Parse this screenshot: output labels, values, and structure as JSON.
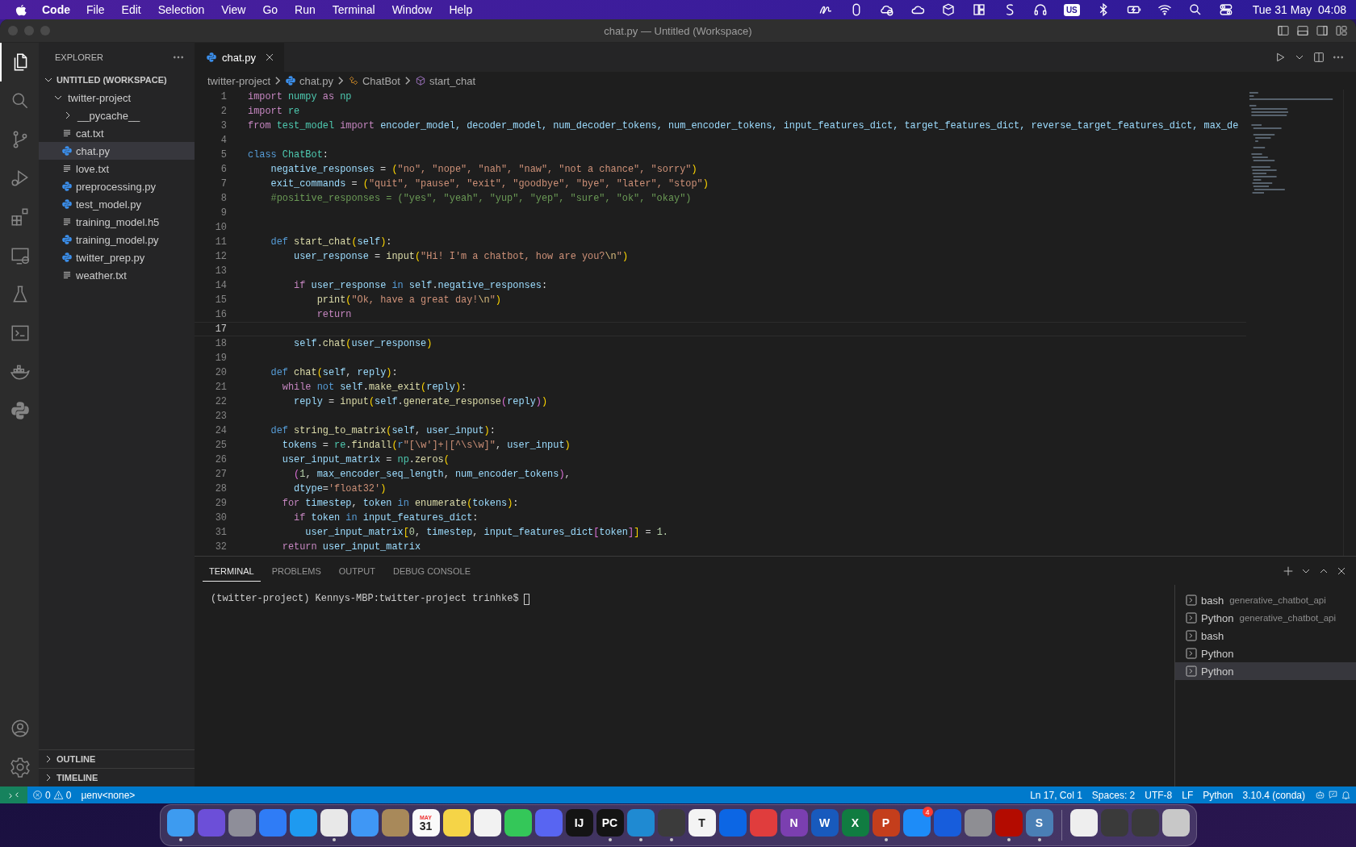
{
  "menu_bar": {
    "app": "Code",
    "menus": [
      "File",
      "Edit",
      "Selection",
      "View",
      "Go",
      "Run",
      "Terminal",
      "Window",
      "Help"
    ],
    "input_source": "US",
    "clock": "Tue 31 May  04:08"
  },
  "window": {
    "title": "chat.py — Untitled (Workspace)"
  },
  "activity_bar": {
    "items": [
      {
        "selected": true
      },
      {
        "selected": false
      },
      {
        "selected": false
      },
      {
        "selected": false
      },
      {
        "selected": false
      },
      {
        "selected": false
      },
      {
        "selected": false
      },
      {
        "selected": false
      },
      {
        "selected": false
      },
      {
        "selected": false
      }
    ]
  },
  "sidebar": {
    "title": "EXPLORER",
    "workspace": {
      "label": "UNTITLED (WORKSPACE)",
      "expanded": true,
      "children": [
        {
          "label": "twitter-project",
          "kind": "folder",
          "expanded": true,
          "selected": false,
          "children": [
            {
              "label": "__pycache__",
              "kind": "folder",
              "expanded": false,
              "selected": false
            },
            {
              "label": "cat.txt",
              "kind": "text",
              "selected": false
            },
            {
              "label": "chat.py",
              "kind": "python",
              "selected": true
            },
            {
              "label": "love.txt",
              "kind": "text",
              "selected": false
            },
            {
              "label": "preprocessing.py",
              "kind": "python",
              "selected": false
            },
            {
              "label": "test_model.py",
              "kind": "python",
              "selected": false
            },
            {
              "label": "training_model.h5",
              "kind": "text",
              "selected": false
            },
            {
              "label": "training_model.py",
              "kind": "python",
              "selected": false
            },
            {
              "label": "twitter_prep.py",
              "kind": "python",
              "selected": false
            },
            {
              "label": "weather.txt",
              "kind": "text",
              "selected": false
            }
          ]
        }
      ]
    },
    "sections": [
      {
        "label": "OUTLINE",
        "expanded": false
      },
      {
        "label": "TIMELINE",
        "expanded": false
      }
    ]
  },
  "editor": {
    "tabs": [
      {
        "label": "chat.py",
        "kind": "python",
        "selected": true
      }
    ],
    "breadcrumb": [
      {
        "label": "twitter-project",
        "kind": "folder"
      },
      {
        "label": "chat.py",
        "kind": "python"
      },
      {
        "label": "ChatBot",
        "kind": "class"
      },
      {
        "label": "start_chat",
        "kind": "method"
      }
    ],
    "lines": [
      {
        "number": "1",
        "current": false,
        "tokens": [
          {
            "kind": "keyword",
            "text": "import "
          },
          {
            "kind": "type",
            "text": "numpy "
          },
          {
            "kind": "keyword",
            "text": "as "
          },
          {
            "kind": "type",
            "text": "np"
          }
        ]
      },
      {
        "number": "2",
        "current": false,
        "tokens": [
          {
            "kind": "keyword",
            "text": "import "
          },
          {
            "kind": "type",
            "text": "re"
          }
        ]
      },
      {
        "number": "3",
        "current": false,
        "tokens": [
          {
            "kind": "keyword",
            "text": "from "
          },
          {
            "kind": "type",
            "text": "test_model "
          },
          {
            "kind": "keyword",
            "text": "import "
          },
          {
            "kind": "variable",
            "text": "encoder_model, decoder_model, num_decoder_tokens, num_encoder_tokens, input_features_dict, target_features_dict, reverse_target_features_dict, max_de"
          }
        ]
      },
      {
        "number": "4",
        "current": false
      },
      {
        "number": "5",
        "current": false,
        "tokens": [
          {
            "kind": "storage",
            "text": "class "
          },
          {
            "kind": "type",
            "text": "ChatBot"
          },
          {
            "kind": "plain",
            "text": ":"
          }
        ]
      },
      {
        "number": "6",
        "current": false,
        "tokens": [
          {
            "kind": "variable",
            "text": "    negative_responses"
          },
          {
            "kind": "plain",
            "text": " = "
          },
          {
            "kind": "bracket",
            "text": "("
          },
          {
            "kind": "string",
            "text": "\"no\", \"nope\", \"nah\", \"naw\", \"not a chance\", \"sorry\""
          },
          {
            "kind": "bracket",
            "text": ")"
          }
        ]
      },
      {
        "number": "7",
        "current": false,
        "tokens": [
          {
            "kind": "variable",
            "text": "    exit_commands"
          },
          {
            "kind": "plain",
            "text": " = "
          },
          {
            "kind": "bracket",
            "text": "("
          },
          {
            "kind": "string",
            "text": "\"quit\", \"pause\", \"exit\", \"goodbye\", \"bye\", \"later\", \"stop\""
          },
          {
            "kind": "bracket",
            "text": ")"
          }
        ]
      },
      {
        "number": "8",
        "current": false,
        "tokens": [
          {
            "kind": "comment",
            "text": "    #positive_responses = (\"yes\", \"yeah\", \"yup\", \"yep\", \"sure\", \"ok\", \"okay\")"
          }
        ]
      },
      {
        "number": "9",
        "current": false
      },
      {
        "number": "10",
        "current": false
      },
      {
        "number": "11",
        "current": false,
        "tokens": [
          {
            "kind": "storage",
            "text": "    def "
          },
          {
            "kind": "function",
            "text": "start_chat"
          },
          {
            "kind": "bracket",
            "text": "("
          },
          {
            "kind": "variable",
            "text": "self"
          },
          {
            "kind": "bracket",
            "text": ")"
          },
          {
            "kind": "plain",
            "text": ":"
          }
        ]
      },
      {
        "number": "12",
        "current": false,
        "tokens": [
          {
            "kind": "variable",
            "text": "        user_response"
          },
          {
            "kind": "plain",
            "text": " = "
          },
          {
            "kind": "function",
            "text": "input"
          },
          {
            "kind": "bracket",
            "text": "("
          },
          {
            "kind": "string",
            "text": "\"Hi! I'm a chatbot, how are you?"
          },
          {
            "kind": "escape",
            "text": "\\n"
          },
          {
            "kind": "string",
            "text": "\""
          },
          {
            "kind": "bracket",
            "text": ")"
          }
        ]
      },
      {
        "number": "13",
        "current": false
      },
      {
        "number": "14",
        "current": false,
        "tokens": [
          {
            "kind": "keyword",
            "text": "        if "
          },
          {
            "kind": "variable",
            "text": "user_response "
          },
          {
            "kind": "storage",
            "text": "in "
          },
          {
            "kind": "variable",
            "text": "self"
          },
          {
            "kind": "plain",
            "text": "."
          },
          {
            "kind": "variable",
            "text": "negative_responses"
          },
          {
            "kind": "plain",
            "text": ":"
          }
        ]
      },
      {
        "number": "15",
        "current": false,
        "tokens": [
          {
            "kind": "function",
            "text": "            print"
          },
          {
            "kind": "bracket",
            "text": "("
          },
          {
            "kind": "string",
            "text": "\"Ok, have a great day!"
          },
          {
            "kind": "escape",
            "text": "\\n"
          },
          {
            "kind": "string",
            "text": "\""
          },
          {
            "kind": "bracket",
            "text": ")"
          }
        ]
      },
      {
        "number": "16",
        "current": false,
        "tokens": [
          {
            "kind": "keyword",
            "text": "            return"
          }
        ]
      },
      {
        "number": "17",
        "current": true
      },
      {
        "number": "18",
        "current": false,
        "tokens": [
          {
            "kind": "variable",
            "text": "        self"
          },
          {
            "kind": "plain",
            "text": "."
          },
          {
            "kind": "function",
            "text": "chat"
          },
          {
            "kind": "bracket",
            "text": "("
          },
          {
            "kind": "variable",
            "text": "user_response"
          },
          {
            "kind": "bracket",
            "text": ")"
          }
        ]
      },
      {
        "number": "19",
        "current": false
      },
      {
        "number": "20",
        "current": false,
        "tokens": [
          {
            "kind": "storage",
            "text": "    def "
          },
          {
            "kind": "function",
            "text": "chat"
          },
          {
            "kind": "bracket",
            "text": "("
          },
          {
            "kind": "variable",
            "text": "self"
          },
          {
            "kind": "plain",
            "text": ", "
          },
          {
            "kind": "variable",
            "text": "reply"
          },
          {
            "kind": "bracket",
            "text": ")"
          },
          {
            "kind": "plain",
            "text": ":"
          }
        ]
      },
      {
        "number": "21",
        "current": false,
        "tokens": [
          {
            "kind": "keyword",
            "text": "      while "
          },
          {
            "kind": "storage",
            "text": "not "
          },
          {
            "kind": "variable",
            "text": "self"
          },
          {
            "kind": "plain",
            "text": "."
          },
          {
            "kind": "function",
            "text": "make_exit"
          },
          {
            "kind": "bracket",
            "text": "("
          },
          {
            "kind": "variable",
            "text": "reply"
          },
          {
            "kind": "bracket",
            "text": ")"
          },
          {
            "kind": "plain",
            "text": ":"
          }
        ]
      },
      {
        "number": "22",
        "current": false,
        "tokens": [
          {
            "kind": "variable",
            "text": "        reply"
          },
          {
            "kind": "plain",
            "text": " = "
          },
          {
            "kind": "function",
            "text": "input"
          },
          {
            "kind": "bracket",
            "text": "("
          },
          {
            "kind": "variable",
            "text": "self"
          },
          {
            "kind": "plain",
            "text": "."
          },
          {
            "kind": "function",
            "text": "generate_response"
          },
          {
            "kind": "bracket2",
            "text": "("
          },
          {
            "kind": "variable",
            "text": "reply"
          },
          {
            "kind": "bracket2",
            "text": ")"
          },
          {
            "kind": "bracket",
            "text": ")"
          }
        ]
      },
      {
        "number": "23",
        "current": false
      },
      {
        "number": "24",
        "current": false,
        "tokens": [
          {
            "kind": "storage",
            "text": "    def "
          },
          {
            "kind": "function",
            "text": "string_to_matrix"
          },
          {
            "kind": "bracket",
            "text": "("
          },
          {
            "kind": "variable",
            "text": "self"
          },
          {
            "kind": "plain",
            "text": ", "
          },
          {
            "kind": "variable",
            "text": "user_input"
          },
          {
            "kind": "bracket",
            "text": ")"
          },
          {
            "kind": "plain",
            "text": ":"
          }
        ]
      },
      {
        "number": "25",
        "current": false,
        "tokens": [
          {
            "kind": "variable",
            "text": "      tokens"
          },
          {
            "kind": "plain",
            "text": " = "
          },
          {
            "kind": "type",
            "text": "re"
          },
          {
            "kind": "plain",
            "text": "."
          },
          {
            "kind": "function",
            "text": "findall"
          },
          {
            "kind": "bracket",
            "text": "("
          },
          {
            "kind": "storage",
            "text": "r"
          },
          {
            "kind": "string",
            "text": "\"[\\w']+|[^\\s\\w]\""
          },
          {
            "kind": "plain",
            "text": ", "
          },
          {
            "kind": "variable",
            "text": "user_input"
          },
          {
            "kind": "bracket",
            "text": ")"
          }
        ]
      },
      {
        "number": "26",
        "current": false,
        "tokens": [
          {
            "kind": "variable",
            "text": "      user_input_matrix"
          },
          {
            "kind": "plain",
            "text": " = "
          },
          {
            "kind": "type",
            "text": "np"
          },
          {
            "kind": "plain",
            "text": "."
          },
          {
            "kind": "function",
            "text": "zeros"
          },
          {
            "kind": "bracket",
            "text": "("
          }
        ]
      },
      {
        "number": "27",
        "current": false,
        "tokens": [
          {
            "kind": "bracket2",
            "text": "        ("
          },
          {
            "kind": "number",
            "text": "1"
          },
          {
            "kind": "plain",
            "text": ", "
          },
          {
            "kind": "variable",
            "text": "max_encoder_seq_length"
          },
          {
            "kind": "plain",
            "text": ", "
          },
          {
            "kind": "variable",
            "text": "num_encoder_tokens"
          },
          {
            "kind": "bracket2",
            "text": ")"
          },
          {
            "kind": "plain",
            "text": ","
          }
        ]
      },
      {
        "number": "28",
        "current": false,
        "tokens": [
          {
            "kind": "variable",
            "text": "        dtype"
          },
          {
            "kind": "plain",
            "text": "="
          },
          {
            "kind": "string",
            "text": "'float32'"
          },
          {
            "kind": "bracket",
            "text": ")"
          }
        ]
      },
      {
        "number": "29",
        "current": false,
        "tokens": [
          {
            "kind": "keyword",
            "text": "      for "
          },
          {
            "kind": "variable",
            "text": "timestep"
          },
          {
            "kind": "plain",
            "text": ", "
          },
          {
            "kind": "variable",
            "text": "token "
          },
          {
            "kind": "storage",
            "text": "in "
          },
          {
            "kind": "function",
            "text": "enumerate"
          },
          {
            "kind": "bracket",
            "text": "("
          },
          {
            "kind": "variable",
            "text": "tokens"
          },
          {
            "kind": "bracket",
            "text": ")"
          },
          {
            "kind": "plain",
            "text": ":"
          }
        ]
      },
      {
        "number": "30",
        "current": false,
        "tokens": [
          {
            "kind": "keyword",
            "text": "        if "
          },
          {
            "kind": "variable",
            "text": "token "
          },
          {
            "kind": "storage",
            "text": "in "
          },
          {
            "kind": "variable",
            "text": "input_features_dict"
          },
          {
            "kind": "plain",
            "text": ":"
          }
        ]
      },
      {
        "number": "31",
        "current": false,
        "tokens": [
          {
            "kind": "variable",
            "text": "          user_input_matrix"
          },
          {
            "kind": "bracket",
            "text": "["
          },
          {
            "kind": "number",
            "text": "0"
          },
          {
            "kind": "plain",
            "text": ", "
          },
          {
            "kind": "variable",
            "text": "timestep"
          },
          {
            "kind": "plain",
            "text": ", "
          },
          {
            "kind": "variable",
            "text": "input_features_dict"
          },
          {
            "kind": "bracket2",
            "text": "["
          },
          {
            "kind": "variable",
            "text": "token"
          },
          {
            "kind": "bracket2",
            "text": "]"
          },
          {
            "kind": "bracket",
            "text": "]"
          },
          {
            "kind": "plain",
            "text": " = "
          },
          {
            "kind": "number",
            "text": "1."
          }
        ]
      },
      {
        "number": "32",
        "current": false,
        "tokens": [
          {
            "kind": "keyword",
            "text": "      return "
          },
          {
            "kind": "variable",
            "text": "user_input_matrix"
          }
        ]
      }
    ]
  },
  "panel": {
    "tabs": [
      {
        "label": "TERMINAL",
        "selected": true
      },
      {
        "label": "PROBLEMS",
        "selected": false
      },
      {
        "label": "OUTPUT",
        "selected": false
      },
      {
        "label": "DEBUG CONSOLE",
        "selected": false
      }
    ],
    "terminal": {
      "prompt": "(twitter-project) Kennys-MBP:twitter-project trinhke$"
    },
    "sessions": [
      {
        "name": "bash",
        "detail": "generative_chatbot_api",
        "selected": false
      },
      {
        "name": "Python",
        "detail": "generative_chatbot_api",
        "selected": false
      },
      {
        "name": "bash",
        "selected": false
      },
      {
        "name": "Python",
        "selected": false
      },
      {
        "name": "Python",
        "selected": true
      }
    ]
  },
  "status_bar": {
    "errors": "0",
    "warnings": "0",
    "env": "µenv<none>",
    "items": [
      "Ln 17, Col 1",
      "Spaces: 2",
      "UTF-8",
      "LF",
      "Python",
      "3.10.4 (conda)"
    ]
  },
  "dock": {
    "apps": [
      {
        "color": "#3d9bf0",
        "running": true
      },
      {
        "color": "#6c4fd8",
        "running": false
      },
      {
        "color": "#8e8e99",
        "running": false
      },
      {
        "color": "#2f7cf6",
        "running": false
      },
      {
        "color": "#1e9af0",
        "running": false
      },
      {
        "color": "#e8e8e8",
        "running": true
      },
      {
        "color": "#3f97f5",
        "running": false
      },
      {
        "color": "#a8895a",
        "running": false
      },
      {
        "color": "#fafafa",
        "label": "31",
        "caption": "MAY",
        "running": false
      },
      {
        "color": "#f5d447",
        "running": false
      },
      {
        "color": "#f2f2f2",
        "running": false
      },
      {
        "color": "#34c759",
        "running": false
      },
      {
        "color": "#5865f2",
        "running": false
      },
      {
        "color": "#141414",
        "label": "IJ",
        "running": false
      },
      {
        "color": "#141414",
        "label": "PC",
        "running": true
      },
      {
        "color": "#1f8ad2",
        "running": true
      },
      {
        "color": "#3b3b3b",
        "running": true
      },
      {
        "color": "#f4f4f4",
        "label": "T",
        "running": false
      },
      {
        "color": "#0c66e4",
        "running": false
      },
      {
        "color": "#e03d3d",
        "running": false
      },
      {
        "color": "#7b3fb0",
        "label": "N",
        "running": false
      },
      {
        "color": "#185abd",
        "label": "W",
        "running": false
      },
      {
        "color": "#107c41",
        "label": "X",
        "running": false
      },
      {
        "color": "#c43e1c",
        "label": "P",
        "running": true
      },
      {
        "color": "#1d8cf8",
        "badge": "4",
        "running": false
      },
      {
        "color": "#175ddc",
        "running": false
      },
      {
        "color": "#8e8e93",
        "running": false
      },
      {
        "color": "#b30b00",
        "running": true
      },
      {
        "color": "#4a7fb5",
        "label": "S",
        "running": true
      }
    ],
    "extras": [
      {
        "color": "#eeeeee"
      },
      {
        "color": "#3a3a3a"
      },
      {
        "color": "#3a3a3a"
      },
      {
        "color": "#c8c8c8"
      }
    ]
  }
}
